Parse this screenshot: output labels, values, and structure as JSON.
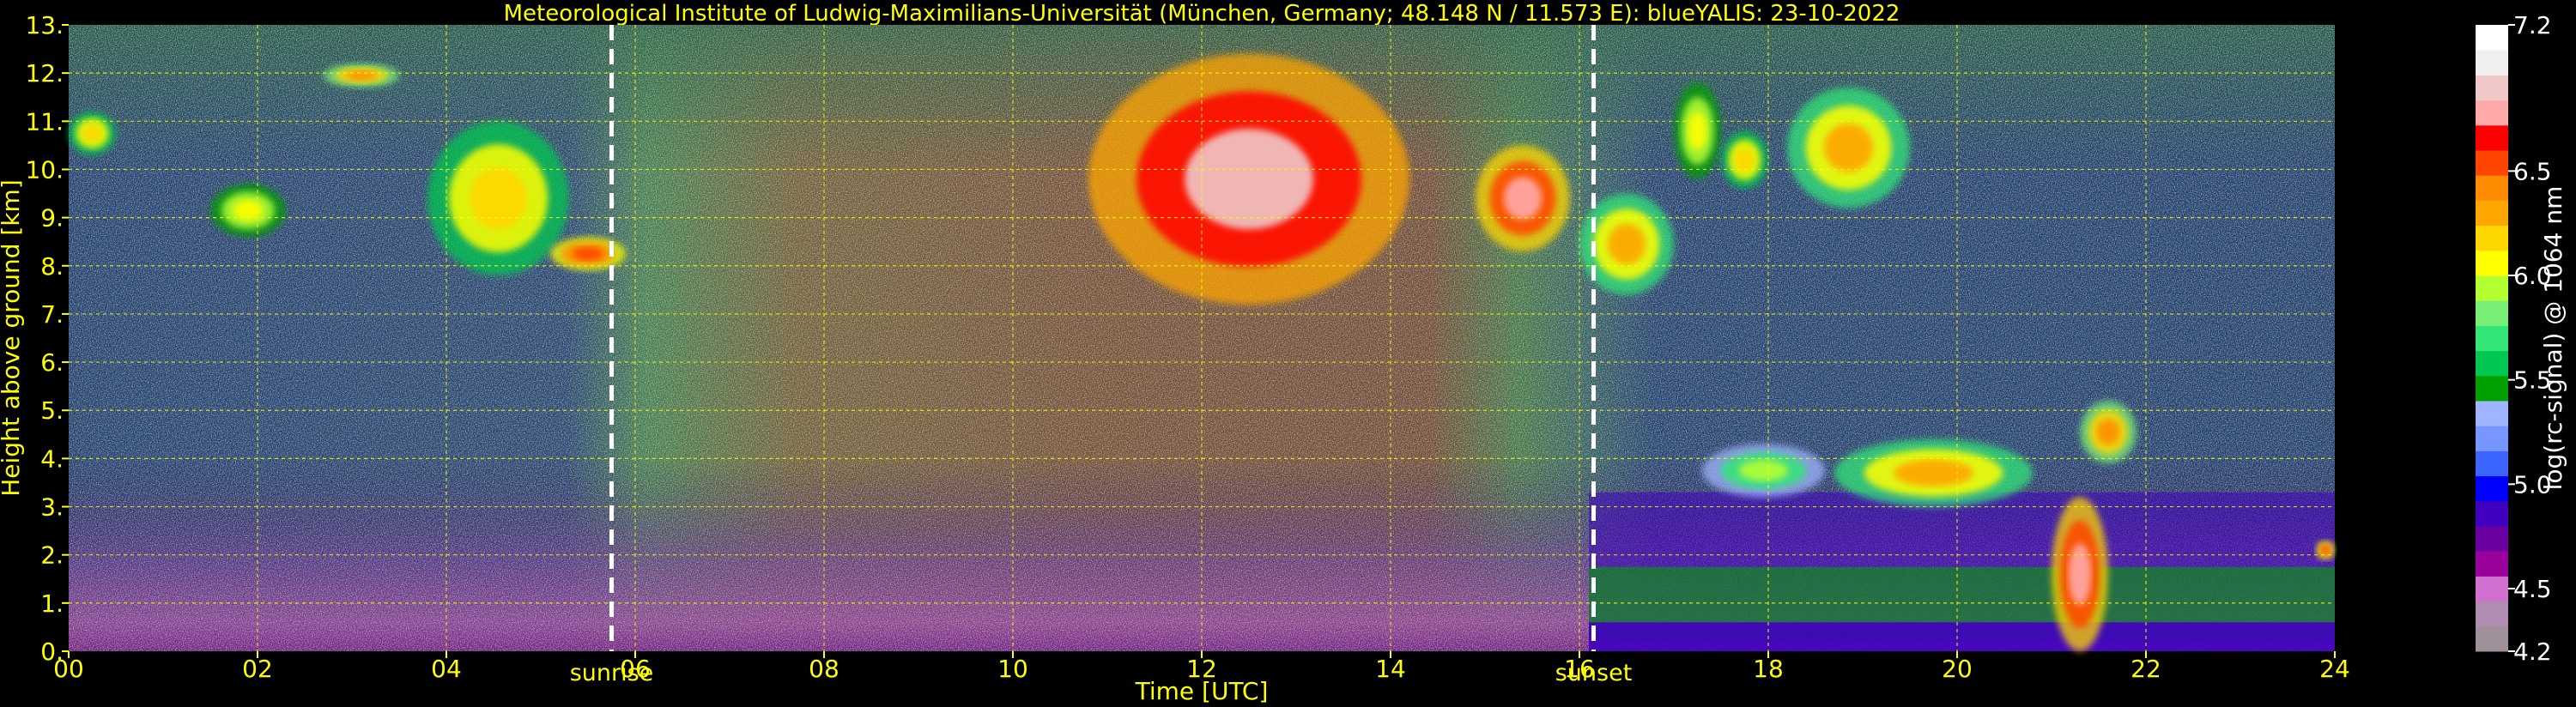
{
  "chart_data": {
    "type": "heatmap",
    "title": "Meteorological Institute of Ludwig-Maximilians-Universität (München, Germany; 48.148 N / 11.573 E):     blueYALIS: 23-10-2022",
    "xlabel": "Time [UTC]",
    "ylabel": "Height above ground [km]",
    "xlim": [
      0,
      24
    ],
    "ylim": [
      0,
      13
    ],
    "x_ticks": [
      0,
      2,
      4,
      6,
      8,
      10,
      12,
      14,
      16,
      18,
      20,
      22,
      24
    ],
    "x_tick_labels": [
      "00",
      "02",
      "04",
      "06",
      "08",
      "10",
      "12",
      "14",
      "16",
      "18",
      "20",
      "22",
      "24"
    ],
    "y_ticks": [
      0,
      1,
      2,
      3,
      4,
      5,
      6,
      7,
      8,
      9,
      10,
      11,
      12,
      13
    ],
    "y_tick_labels": [
      "0.",
      "1.",
      "2.",
      "3.",
      "4.",
      "5.",
      "6.",
      "7.",
      "8.",
      "9.",
      "10.",
      "11.",
      "12.",
      "13."
    ],
    "grid": true,
    "annotations": [
      {
        "label": "sunrise",
        "x": 5.75
      },
      {
        "label": "sunset",
        "x": 16.15
      }
    ],
    "colorbar": {
      "label": "log(rc-signal) @ 1064 nm",
      "range": [
        4.2,
        7.2
      ],
      "ticks": [
        4.2,
        4.5,
        5.0,
        5.5,
        6.0,
        6.5,
        7.2
      ],
      "tick_labels": [
        "4.2",
        "4.5",
        "5.0",
        "5.5",
        "6.0",
        "6.5",
        "7.2"
      ],
      "colors": [
        "#a0909a",
        "#b08cb0",
        "#d070d0",
        "#9a009a",
        "#6a00a0",
        "#4000c0",
        "#0000ff",
        "#3c64ff",
        "#7896ff",
        "#a0b4ff",
        "#00a000",
        "#00c850",
        "#32e678",
        "#78f078",
        "#b4ff32",
        "#ffff00",
        "#ffd700",
        "#ffa500",
        "#ff8c00",
        "#ff4500",
        "#ff0000",
        "#ffaaaa",
        "#f0c8c8",
        "#f0f0f0",
        "#ffffff"
      ]
    },
    "features": [
      {
        "kind": "cirrus",
        "t0": 0.0,
        "t1": 0.5,
        "h0": 10.3,
        "h1": 11.2,
        "level": 6.2
      },
      {
        "kind": "cirrus",
        "t0": 1.5,
        "t1": 2.3,
        "h0": 8.6,
        "h1": 9.7,
        "level": 6.1
      },
      {
        "kind": "cirrus",
        "t0": 2.7,
        "t1": 3.5,
        "h0": 11.7,
        "h1": 12.2,
        "level": 6.4
      },
      {
        "kind": "cirrus",
        "t0": 3.8,
        "t1": 5.3,
        "h0": 7.8,
        "h1": 11.0,
        "level": 6.2
      },
      {
        "kind": "cirrus",
        "t0": 5.1,
        "t1": 5.9,
        "h0": 7.9,
        "h1": 8.6,
        "level": 6.6
      },
      {
        "kind": "cirrus",
        "t0": 10.8,
        "t1": 14.2,
        "h0": 7.2,
        "h1": 12.4,
        "level": 6.9
      },
      {
        "kind": "cirrus",
        "t0": 14.9,
        "t1": 15.9,
        "h0": 8.3,
        "h1": 10.5,
        "level": 6.8
      },
      {
        "kind": "cirrus",
        "t0": 16.0,
        "t1": 17.0,
        "h0": 7.4,
        "h1": 9.5,
        "level": 6.3
      },
      {
        "kind": "cirrus",
        "t0": 17.0,
        "t1": 17.5,
        "h0": 9.8,
        "h1": 11.8,
        "level": 6.1
      },
      {
        "kind": "cirrus",
        "t0": 18.2,
        "t1": 19.5,
        "h0": 9.2,
        "h1": 11.7,
        "level": 6.3
      },
      {
        "kind": "cirrus",
        "t0": 17.5,
        "t1": 18.0,
        "h0": 9.6,
        "h1": 10.8,
        "level": 6.2
      },
      {
        "kind": "aerosol",
        "t0": 16.1,
        "t1": 24.0,
        "h0": 0.2,
        "h1": 3.3,
        "level": 5.5
      },
      {
        "kind": "cloud",
        "t0": 18.7,
        "t1": 20.8,
        "h0": 3.0,
        "h1": 4.4,
        "level": 6.3
      },
      {
        "kind": "cloud",
        "t0": 21.0,
        "t1": 21.6,
        "h0": 0.0,
        "h1": 3.2,
        "level": 6.8
      },
      {
        "kind": "cloud",
        "t0": 21.3,
        "t1": 21.9,
        "h0": 3.9,
        "h1": 5.2,
        "level": 6.4
      },
      {
        "kind": "cloud",
        "t0": 17.3,
        "t1": 18.6,
        "h0": 3.2,
        "h1": 4.3,
        "level": 5.9
      },
      {
        "kind": "cloud",
        "t0": 23.8,
        "t1": 24.0,
        "h0": 1.9,
        "h1": 2.3,
        "level": 6.6
      }
    ]
  }
}
